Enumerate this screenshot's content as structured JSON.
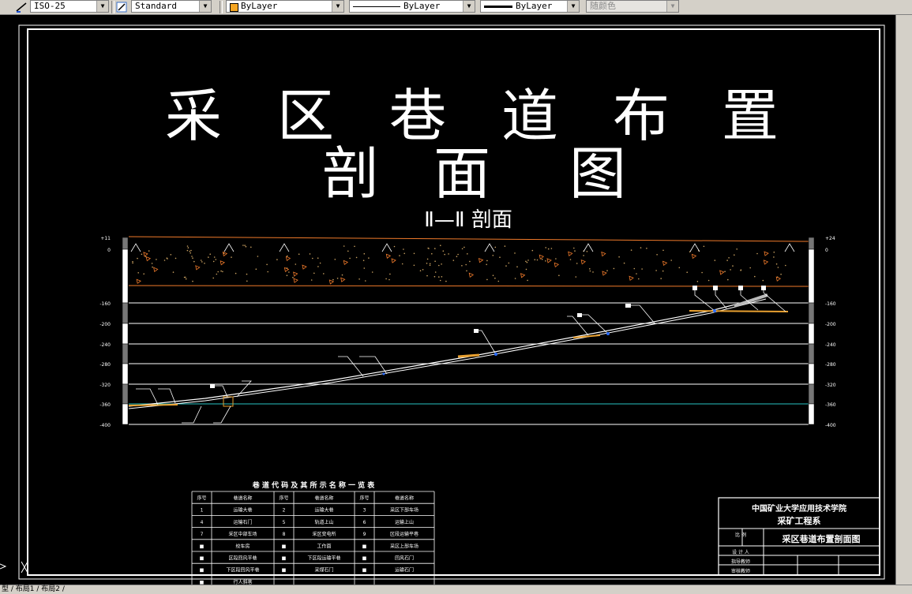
{
  "toolbar": {
    "dimstyle": "ISO-25",
    "textstyle": "Standard",
    "layer": "ByLayer",
    "linetype": "ByLayer",
    "lineweight": "ByLayer",
    "plotstyle": "随颜色"
  },
  "drawing": {
    "title_line1": [
      "采",
      "区",
      "巷",
      "道",
      "布",
      "置"
    ],
    "title_line2": [
      "剖",
      "面",
      "图"
    ],
    "section_label": "Ⅱ—Ⅱ 剖面"
  },
  "profile": {
    "left_elevations": [
      "+11",
      "0",
      "-160",
      "-200",
      "-240",
      "-280",
      "-320",
      "-360",
      "-400"
    ],
    "right_elevations": [
      "+24",
      "0",
      "-160",
      "-200",
      "-240",
      "-280",
      "-320",
      "-360",
      "-400"
    ]
  },
  "legend_table": {
    "title": "巷 道 代 码 及 其 所 示 名 称 一 览 表",
    "headers": [
      "序号",
      "巷道名称",
      "序号",
      "巷道名称",
      "序号",
      "巷道名称"
    ],
    "rows": [
      [
        "1",
        "运输大巷",
        "2",
        "运输大巷",
        "3",
        "采区下部车场"
      ],
      [
        "4",
        "运输石门",
        "5",
        "轨道上山",
        "6",
        "运输上山"
      ],
      [
        "7",
        "采区中部车场",
        "8",
        "采区变电所",
        "9",
        "区段运输平巷"
      ],
      [
        "■",
        "绞车房",
        "■",
        "工作面",
        "■",
        "采区上部车场"
      ],
      [
        "■",
        "区段回风平巷",
        "■",
        "下区段运输平巷",
        "■",
        "回风石门"
      ],
      [
        "■",
        "下区段回风平巷",
        "■",
        "采煤石门",
        "■",
        "运输石门"
      ],
      [
        "■",
        "行人斜巷",
        "",
        "",
        "",
        ""
      ]
    ]
  },
  "title_block": {
    "institution": "中国矿业大学应用技术学院",
    "department": "采矿工程系",
    "drawing_name": "采区巷道布置剖面图",
    "small_labels": [
      "比 例",
      "设 计 人",
      "指导教师",
      "审核教师"
    ]
  },
  "statusbar": {
    "tabs": "型 / 布局1 / 布局2 /"
  },
  "colors": {
    "drawing_bg": "#000000",
    "line_white": "#ffffff",
    "stratum_orange": "#f07a2a",
    "seam_orange": "#e8a030",
    "cyan_line": "#27c4c4"
  }
}
